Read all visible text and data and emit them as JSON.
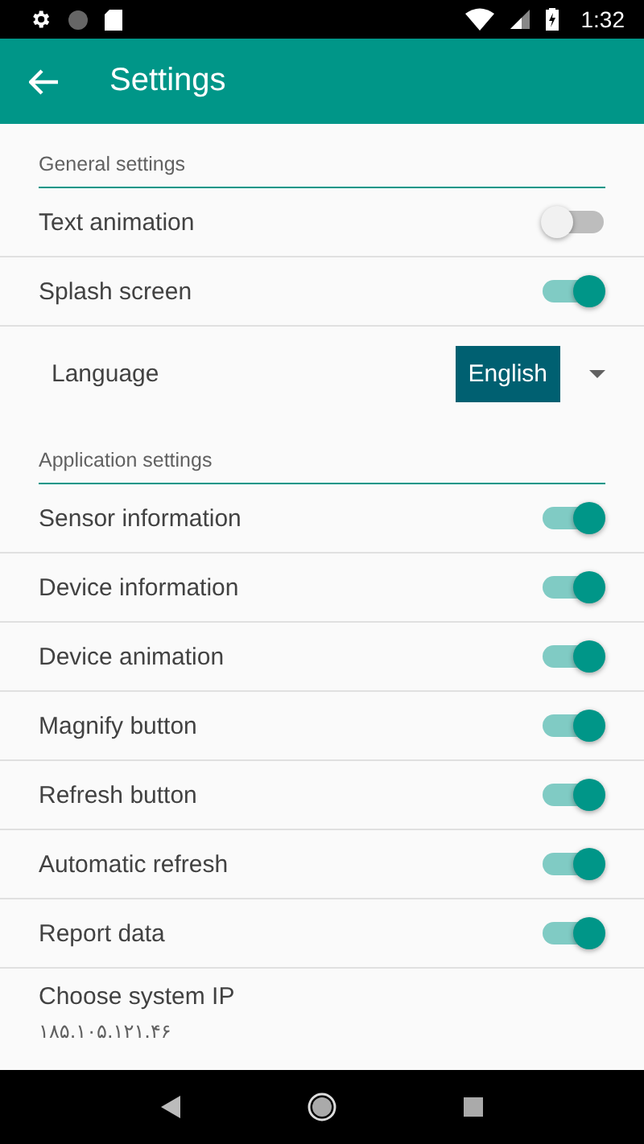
{
  "status_bar": {
    "time": "1:32"
  },
  "app_bar": {
    "title": "Settings"
  },
  "sections": [
    {
      "title": "General settings",
      "items": [
        {
          "kind": "switch",
          "label": "Text animation",
          "on": false
        },
        {
          "kind": "switch",
          "label": "Splash screen",
          "on": true
        },
        {
          "kind": "select",
          "label": "Language",
          "value": "English"
        }
      ]
    },
    {
      "title": "Application settings",
      "items": [
        {
          "kind": "switch",
          "label": "Sensor information",
          "on": true
        },
        {
          "kind": "switch",
          "label": "Device information",
          "on": true
        },
        {
          "kind": "switch",
          "label": "Device animation",
          "on": true
        },
        {
          "kind": "switch",
          "label": "Magnify button",
          "on": true
        },
        {
          "kind": "switch",
          "label": "Refresh button",
          "on": true
        },
        {
          "kind": "switch",
          "label": "Automatic refresh",
          "on": true
        },
        {
          "kind": "switch",
          "label": "Report data",
          "on": true
        },
        {
          "kind": "summary",
          "label": "Choose system IP",
          "summary": "۱۸۵.۱۰۵.۱۲۱.۴۶"
        }
      ]
    }
  ]
}
